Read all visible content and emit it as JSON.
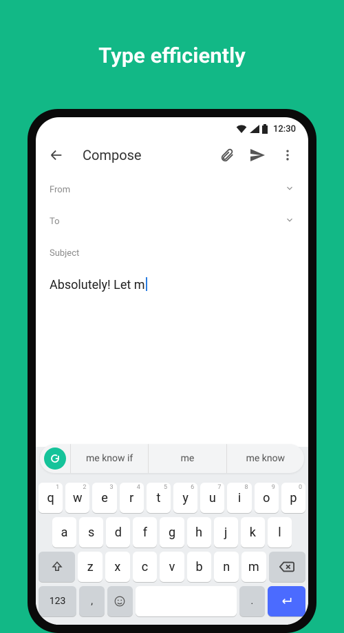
{
  "headline": "Type efficiently",
  "statusbar": {
    "time": "12:30"
  },
  "appbar": {
    "title": "Compose"
  },
  "fields": {
    "from_label": "From",
    "to_label": "To",
    "subject_label": "Subject"
  },
  "body": {
    "text": "Absolutely! Let m"
  },
  "suggestions": {
    "s1": "me know if",
    "s2": "me",
    "s3": "me know"
  },
  "keyboard": {
    "row1": [
      "q",
      "w",
      "e",
      "r",
      "t",
      "y",
      "u",
      "i",
      "o",
      "p"
    ],
    "row1_hints": [
      "1",
      "2",
      "3",
      "4",
      "5",
      "6",
      "7",
      "8",
      "9",
      "0"
    ],
    "row2": [
      "a",
      "s",
      "d",
      "f",
      "g",
      "h",
      "j",
      "k",
      "l"
    ],
    "row3": [
      "z",
      "x",
      "c",
      "v",
      "b",
      "n",
      "m"
    ],
    "sym_label": "123",
    "comma": ",",
    "period": "."
  }
}
